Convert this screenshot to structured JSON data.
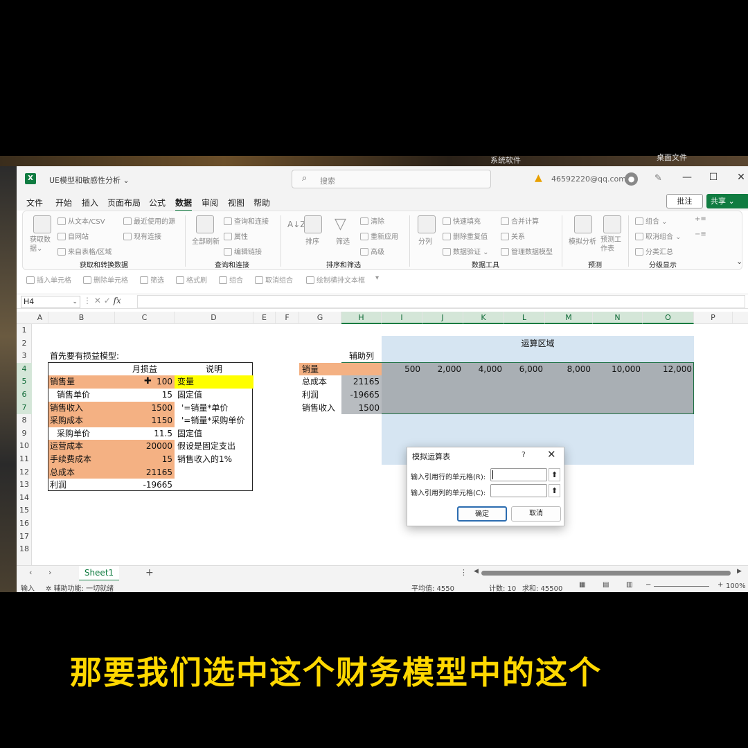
{
  "desktop": {
    "label1": "系统软件",
    "label2": "桌面文件"
  },
  "titlebar": {
    "app_icon": "X",
    "doc_title": "UE模型和敏感性分析 ⌄",
    "search_placeholder": "搜索",
    "account": "46592220@qq.com"
  },
  "menu": {
    "items": [
      "文件",
      "开始",
      "插入",
      "页面布局",
      "公式",
      "数据",
      "审阅",
      "视图",
      "帮助"
    ],
    "active": "数据",
    "comment": "批注",
    "share": "共享 ⌄"
  },
  "ribbon": {
    "get_data": {
      "big": "获取数据⌄",
      "items": [
        "从文本/CSV",
        "自网站",
        "来自表格/区域",
        "最近使用的源",
        "现有连接"
      ],
      "group": "获取和转换数据"
    },
    "query": {
      "big": "全部刷新",
      "items": [
        "查询和连接",
        "属性",
        "编辑链接"
      ],
      "group": "查询和连接"
    },
    "sort": {
      "items": [
        "排序",
        "筛选",
        "清除",
        "重新应用",
        "高级"
      ],
      "group": "排序和筛选"
    },
    "tools": {
      "items": [
        "分列",
        "快速填充",
        "删除重复值",
        "数据验证 ⌄",
        "合并计算",
        "关系",
        "管理数据模型"
      ],
      "group": "数据工具"
    },
    "forecast": {
      "items": [
        "模拟分析",
        "预测工作表"
      ],
      "group": "预测"
    },
    "outline": {
      "items": [
        "组合 ⌄",
        "取消组合 ⌄",
        "分类汇总"
      ],
      "group": "分级显示"
    }
  },
  "qat": [
    "插入单元格",
    "删除单元格",
    "筛选",
    "格式刷",
    "组合",
    "取消组合",
    "绘制横排文本框"
  ],
  "formula_bar": {
    "name_box": "H4",
    "formula": ""
  },
  "columns": [
    "A",
    "B",
    "C",
    "D",
    "E",
    "F",
    "G",
    "H",
    "I",
    "J",
    "K",
    "L",
    "M",
    "N",
    "O",
    "P"
  ],
  "rows": [
    "1",
    "2",
    "3",
    "4",
    "5",
    "6",
    "7",
    "8",
    "9",
    "10",
    "11",
    "12",
    "13",
    "14",
    "15",
    "16",
    "17",
    "18"
  ],
  "model": {
    "title": "首先要有损益模型:",
    "header_value": "月损益",
    "header_note": "说明",
    "rows": [
      {
        "label": "销售量",
        "value": "100",
        "note": "变量"
      },
      {
        "label": "销售单价",
        "value": "15",
        "note": "固定值"
      },
      {
        "label": "销售收入",
        "value": "1500",
        "note": "'=销量*单价"
      },
      {
        "label": "采购成本",
        "value": "1150",
        "note": "'=销量*采购单价"
      },
      {
        "label": "采购单价",
        "value": "11.5",
        "note": "固定值"
      },
      {
        "label": "运营成本",
        "value": "20000",
        "note": "假设是固定支出"
      },
      {
        "label": "手续费成本",
        "value": "15",
        "note": "销售收入的1%"
      },
      {
        "label": "总成本",
        "value": "21165",
        "note": ""
      },
      {
        "label": "利润",
        "value": "-19665",
        "note": ""
      }
    ]
  },
  "calc": {
    "area_title": "运算区域",
    "helper_header": "辅助列",
    "row_labels": [
      "销量",
      "总成本",
      "利润",
      "销售收入"
    ],
    "helper_values": [
      "",
      "21165",
      "-19665",
      "1500"
    ],
    "volumes": [
      "500",
      "2,000",
      "4,000",
      "6,000",
      "8,000",
      "10,000",
      "12,000"
    ]
  },
  "dialog": {
    "title": "模拟运算表",
    "help": "?",
    "row_input_label": "输入引用行的单元格(R):",
    "col_input_label": "输入引用列的单元格(C):",
    "ok": "确定",
    "cancel": "取消"
  },
  "sheet": {
    "tab": "Sheet1",
    "add": "+"
  },
  "status": {
    "mode": "输入",
    "accessibility": "辅助功能: 一切就绪",
    "average": "平均值: 4550",
    "count": "计数: 10",
    "sum": "求和: 45500",
    "zoom": "100%"
  },
  "caption": "那要我们选中这个财务模型中的这个"
}
